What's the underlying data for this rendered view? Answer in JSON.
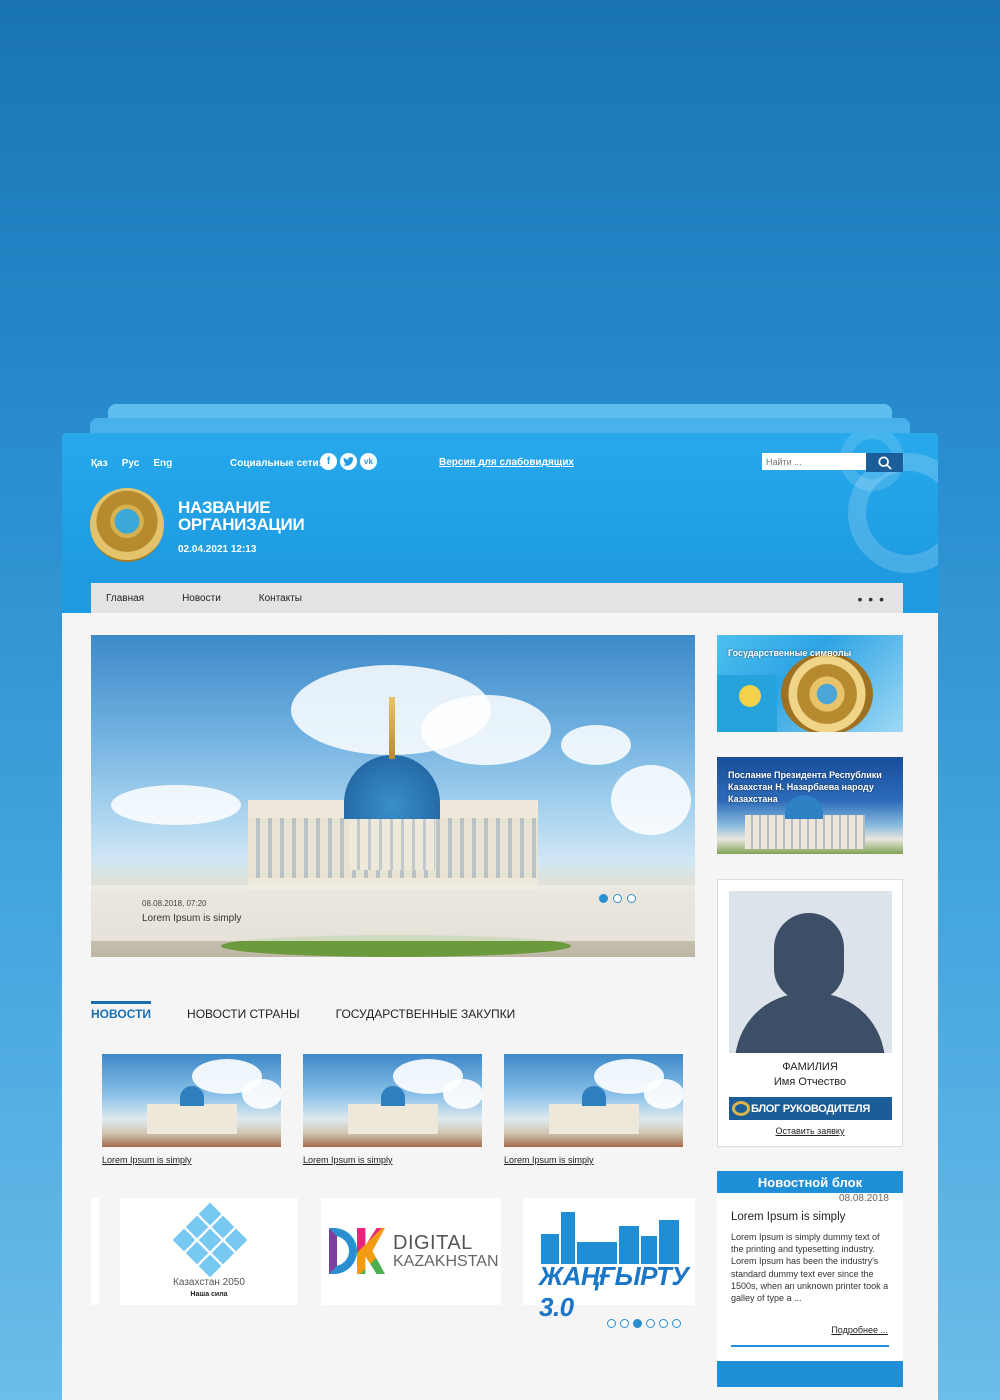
{
  "languages": [
    "Қаз",
    "Рус",
    "Eng"
  ],
  "social": {
    "label": "Социальные сети:",
    "icons": [
      "facebook-icon",
      "twitter-icon",
      "vk-icon"
    ]
  },
  "vision_link": "Версия для слабовидящих",
  "search": {
    "placeholder": "Найти ..."
  },
  "org": {
    "name": "НАЗВАНИЕ ОРГАНИЗАЦИИ",
    "datetime": "02.04.2021 12:13"
  },
  "nav": {
    "items": [
      "Главная",
      "Новости",
      "Контакты"
    ],
    "more": "• • •"
  },
  "slider": {
    "date": "08.08.2018, 07:20",
    "title": "Lorem Ipsum is simply",
    "dot_count": 3,
    "active_dot": 1
  },
  "tabs": [
    "НОВОСТИ",
    "НОВОСТИ СТРАНЫ",
    "ГОСУДАРСТВЕННЫЕ ЗАКУПКИ"
  ],
  "news_cards": [
    {
      "title": "Lorem Ipsum is simply"
    },
    {
      "title": "Lorem Ipsum is simply"
    },
    {
      "title": "Lorem Ipsum is simply"
    }
  ],
  "partners": {
    "kz2050": {
      "line1": "Казахстан 2050",
      "line2": "Наша сила"
    },
    "digital": {
      "line1": "DIGITAL",
      "line2": "KAZAKHSTAN"
    },
    "zhangyrtu": {
      "text": "ЖАҢҒЫРТУ 3.0"
    },
    "dot_count": 6,
    "active_dot": 3
  },
  "banners": [
    {
      "title": "Государственные символы"
    },
    {
      "title": "Послание Президента Республики Казахстан Н. Назарбаева народу Казахстана"
    }
  ],
  "blog": {
    "surname": "ФАМИЛИЯ",
    "name": "Имя Отчество",
    "button": "БЛОГ РУКОВОДИТЕЛЯ",
    "apply": "Оставить заявку"
  },
  "newsblock": {
    "header": "Новостной блок",
    "date": "08.08.2018",
    "title": "Lorem Ipsum is simply",
    "text": "Lorem Ipsum is simply dummy text of the printing and typesetting industry. Lorem Ipsum has been the industry's standard dummy text ever since the 1500s, when an unknown printer took a galley of type a ...",
    "more": "Подробнее ..."
  }
}
